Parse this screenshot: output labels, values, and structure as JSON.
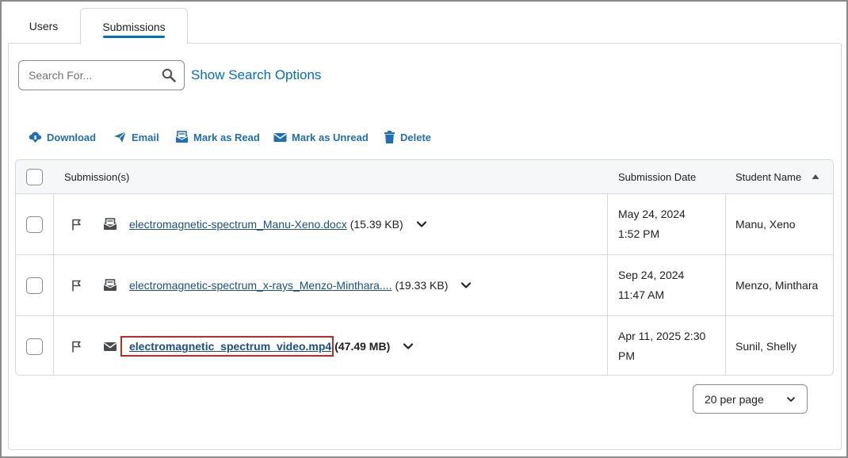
{
  "tabs": [
    {
      "label": "Users"
    },
    {
      "label": "Submissions",
      "active": true
    }
  ],
  "search": {
    "placeholder": "Search For...",
    "value": "",
    "options_link": "Show Search Options"
  },
  "toolbar": {
    "download": "Download",
    "email": "Email",
    "mark_read": "Mark as Read",
    "mark_unread": "Mark as Unread",
    "delete": "Delete"
  },
  "table": {
    "headers": {
      "submissions": "Submission(s)",
      "date": "Submission Date",
      "student": "Student Name"
    },
    "sort_icon": "sort-ascending-icon",
    "rows": [
      {
        "file": "electromagnetic-spectrum_Manu-Xeno.docx",
        "size": "(15.39 KB)",
        "date_line1": "May 24, 2024",
        "date_line2": "1:52 PM",
        "student": "Manu, Xeno",
        "read_state": "read"
      },
      {
        "file": "electromagnetic-spectrum_x-rays_Menzo-Minthara....",
        "size": "(19.33 KB)",
        "date_line1": "Sep 24, 2024",
        "date_line2": "11:47 AM",
        "student": "Menzo, Minthara",
        "read_state": "read"
      },
      {
        "file": "electromagnetic_spectrum_video.mp4",
        "size": "(47.49 MB)",
        "date_line1": "Apr 11, 2025 2:30",
        "date_line2": "PM",
        "student": "Sunil, Shelly",
        "read_state": "unread",
        "highlighted": true
      }
    ]
  },
  "pager": {
    "per_page": "20 per page"
  },
  "colors": {
    "accent": "#006fbf",
    "link": "#1a4f8a",
    "highlight": "#c62828",
    "border": "#d3d9e3"
  }
}
